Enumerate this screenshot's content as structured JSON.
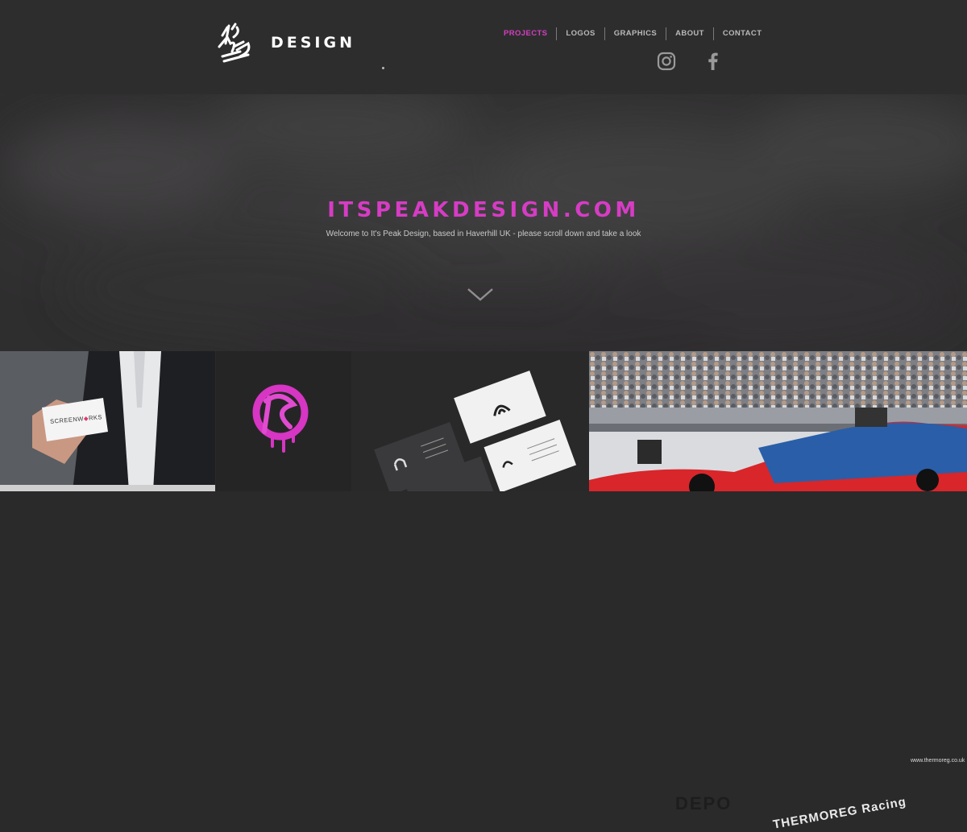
{
  "header": {
    "logo_word": "DESIGN",
    "nav": [
      {
        "label": "PROJECTS",
        "active": true
      },
      {
        "label": "LOGOS",
        "active": false
      },
      {
        "label": "GRAPHICS",
        "active": false
      },
      {
        "label": "ABOUT",
        "active": false
      },
      {
        "label": "CONTACT",
        "active": false
      }
    ],
    "social": [
      "instagram-icon",
      "facebook-icon"
    ]
  },
  "hero": {
    "title": "ITSPEAKDESIGN.COM",
    "subtitle": "Welcome to It's Peak Design, based in Haverhill UK - please scroll down and take a look"
  },
  "gallery": {
    "card_text_a": "SCREENW",
    "card_text_b": "RKS",
    "car_brand": "THERMOREG Racing",
    "banner": "DEPO",
    "website": "www.thermoreg.co.uk"
  },
  "colors": {
    "accent": "#d63cc4",
    "header_bg": "#2e2d2e",
    "hero_bg": "#3a393a"
  }
}
